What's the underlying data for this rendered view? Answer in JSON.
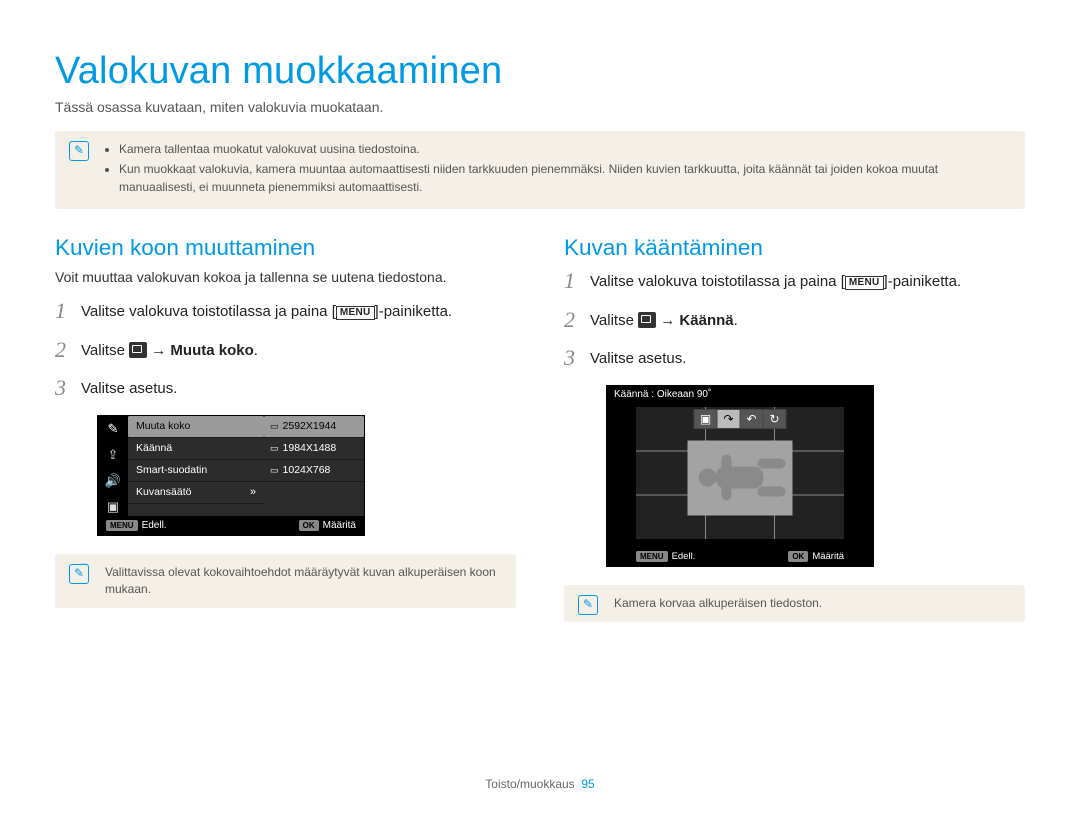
{
  "page": {
    "title": "Valokuvan muokkaaminen",
    "subtitle": "Tässä osassa kuvataan, miten valokuvia muokataan."
  },
  "top_note": {
    "bullets": [
      "Kamera tallentaa muokatut valokuvat uusina tiedostoina.",
      "Kun muokkaat valokuvia, kamera muuntaa automaattisesti niiden tarkkuuden pienemmäksi. Niiden kuvien tarkkuutta, joita käännät tai joiden kokoa muutat manuaalisesti, ei muunneta pienemmiksi automaattisesti."
    ]
  },
  "left": {
    "heading": "Kuvien koon muuttaminen",
    "subtitle": "Voit muuttaa valokuvan kokoa ja tallenna se uutena tiedostona.",
    "steps": {
      "s1_pre": "Valitse valokuva toistotilassa ja paina [",
      "s1_icon": "MENU",
      "s1_post": "]-painiketta.",
      "s2_pre": "Valitse ",
      "s2_arrow": " → ",
      "s2_bold": "Muuta koko",
      "s2_end": ".",
      "s3": "Valitse asetus."
    },
    "menu": {
      "left_items": [
        "Muuta koko",
        "Käännä",
        "Smart-suodatin",
        "Kuvansäätö"
      ],
      "right_items": [
        "2592X1944",
        "1984X1488",
        "1024X768"
      ],
      "more": "»",
      "foot_prev_btn": "MENU",
      "foot_prev_lbl": "Edell.",
      "foot_ok_btn": "OK",
      "foot_ok_lbl": "Määritä"
    },
    "note": "Valittavissa olevat kokovaihtoehdot määräytyvät kuvan alkuperäisen koon mukaan."
  },
  "right": {
    "heading": "Kuvan kääntäminen",
    "steps": {
      "s1_pre": "Valitse valokuva toistotilassa ja paina [",
      "s1_icon": "MENU",
      "s1_post": "]-painiketta.",
      "s2_pre": "Valitse ",
      "s2_arrow": " → ",
      "s2_bold": "Käännä",
      "s2_end": ".",
      "s3": "Valitse asetus."
    },
    "rotate": {
      "title": "Käännä : Oikeaan 90˚",
      "foot_prev_btn": "MENU",
      "foot_prev_lbl": "Edell.",
      "foot_ok_btn": "OK",
      "foot_ok_lbl": "Määritä"
    },
    "note": "Kamera korvaa alkuperäisen tiedoston."
  },
  "footer": {
    "label": "Toisto/muokkaus",
    "page": "95"
  }
}
